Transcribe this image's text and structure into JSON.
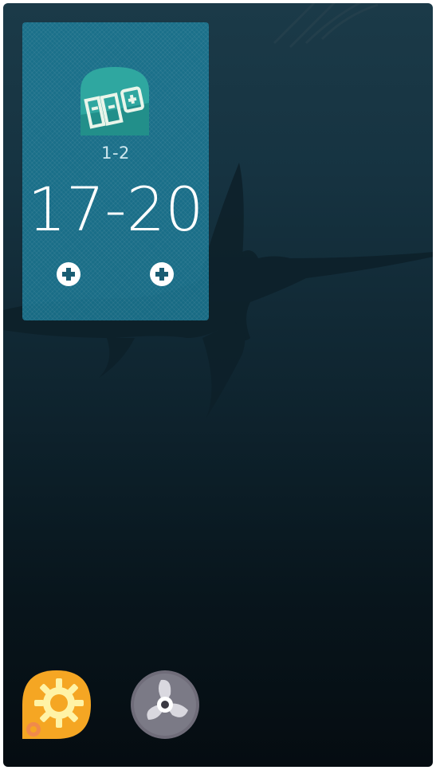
{
  "scoreboard": {
    "set_score": "1-2",
    "points_score": "17-20"
  },
  "icons": {
    "app_logo": "scoreboard-app-icon",
    "plus_left": "plus-circle-icon",
    "plus_right": "plus-circle-icon",
    "dock_settings": "settings-gear-icon",
    "dock_fan": "propeller-fan-icon"
  },
  "colors": {
    "widget_bg": "#1c809e",
    "logo_teal": "#2fa7a0",
    "settings_orange": "#f5a623",
    "settings_yellow": "#fff3a6",
    "fan_gray": "#7b7a86"
  }
}
